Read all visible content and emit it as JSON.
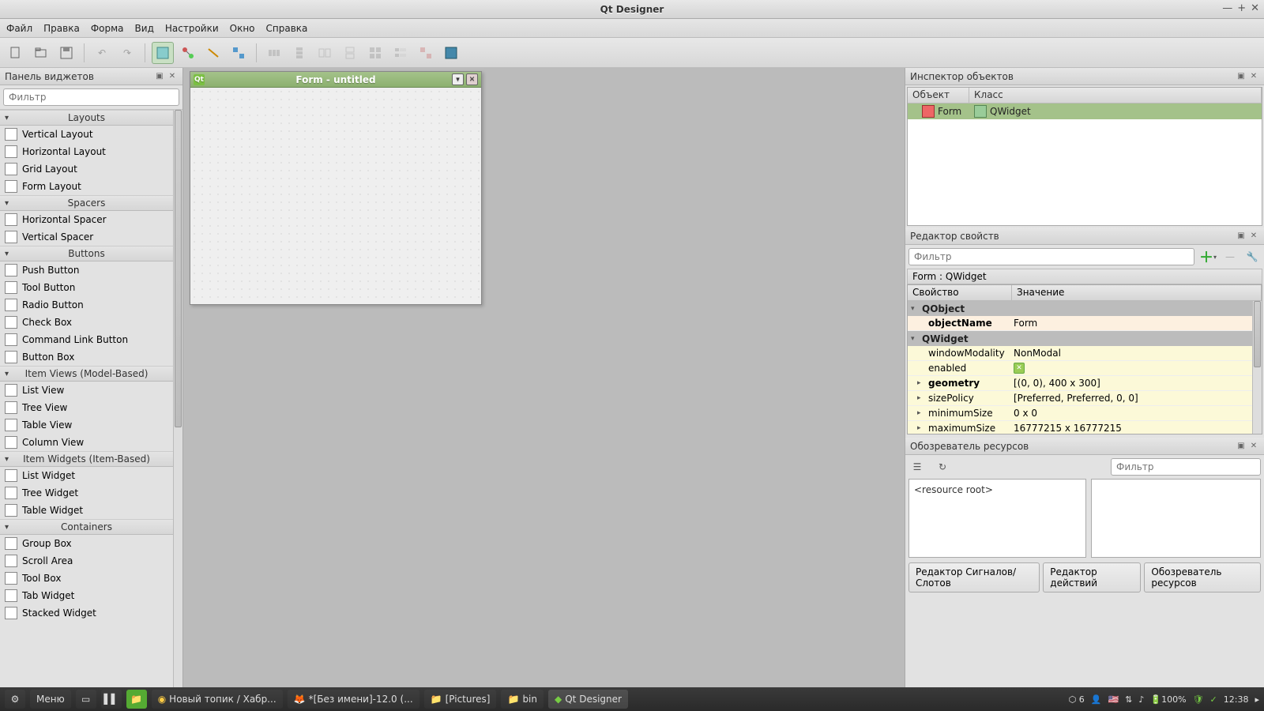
{
  "window_title": "Qt Designer",
  "menu": [
    "Файл",
    "Правка",
    "Форма",
    "Вид",
    "Настройки",
    "Окно",
    "Справка"
  ],
  "widget_box": {
    "title": "Панель виджетов",
    "filter_placeholder": "Фильтр",
    "categories": [
      {
        "name": "Layouts",
        "items": [
          "Vertical Layout",
          "Horizontal Layout",
          "Grid Layout",
          "Form Layout"
        ]
      },
      {
        "name": "Spacers",
        "items": [
          "Horizontal Spacer",
          "Vertical Spacer"
        ]
      },
      {
        "name": "Buttons",
        "items": [
          "Push Button",
          "Tool Button",
          "Radio Button",
          "Check Box",
          "Command Link Button",
          "Button Box"
        ]
      },
      {
        "name": "Item Views (Model-Based)",
        "items": [
          "List View",
          "Tree View",
          "Table View",
          "Column View"
        ]
      },
      {
        "name": "Item Widgets (Item-Based)",
        "items": [
          "List Widget",
          "Tree Widget",
          "Table Widget"
        ]
      },
      {
        "name": "Containers",
        "items": [
          "Group Box",
          "Scroll Area",
          "Tool Box",
          "Tab Widget",
          "Stacked Widget"
        ]
      }
    ]
  },
  "form_window": {
    "title": "Form - untitled"
  },
  "object_inspector": {
    "title": "Инспектор объектов",
    "columns": [
      "Объект",
      "Класс"
    ],
    "rows": [
      {
        "object": "Form",
        "class": "QWidget"
      }
    ]
  },
  "property_editor": {
    "title": "Редактор свойств",
    "filter_placeholder": "Фильтр",
    "form_label": "Form : QWidget",
    "columns": [
      "Свойство",
      "Значение"
    ],
    "groups": [
      {
        "name": "QObject",
        "props": [
          {
            "k": "objectName",
            "v": "Form",
            "bold": true
          }
        ]
      },
      {
        "name": "QWidget",
        "props": [
          {
            "k": "windowModality",
            "v": "NonModal"
          },
          {
            "k": "enabled",
            "v": "",
            "checkbox": true
          },
          {
            "k": "geometry",
            "v": "[(0, 0), 400 x 300]",
            "bold": true,
            "expand": true
          },
          {
            "k": "sizePolicy",
            "v": "[Preferred, Preferred, 0, 0]",
            "expand": true
          },
          {
            "k": "minimumSize",
            "v": "0 x 0",
            "expand": true
          },
          {
            "k": "maximumSize",
            "v": "16777215 x 16777215",
            "expand": true
          }
        ]
      }
    ]
  },
  "resource_browser": {
    "title": "Обозреватель ресурсов",
    "filter_placeholder": "Фильтр",
    "root_label": "<resource root>",
    "tabs": [
      "Редактор Сигналов/Слотов",
      "Редактор действий",
      "Обозреватель ресурсов"
    ]
  },
  "taskbar": {
    "menu_label": "Меню",
    "items": [
      {
        "label": "Новый топик / Хабр...",
        "icon": "chrome"
      },
      {
        "label": "*[Без имени]-12.0 (...",
        "icon": "gimp"
      },
      {
        "label": "[Pictures]",
        "icon": "folder"
      },
      {
        "label": "bin",
        "icon": "folder"
      },
      {
        "label": "Qt Designer",
        "icon": "qt",
        "active": true
      }
    ],
    "tray": {
      "workspaces": "6",
      "battery": "100%",
      "time": "12:38",
      "flag": "🇺🇸"
    }
  }
}
